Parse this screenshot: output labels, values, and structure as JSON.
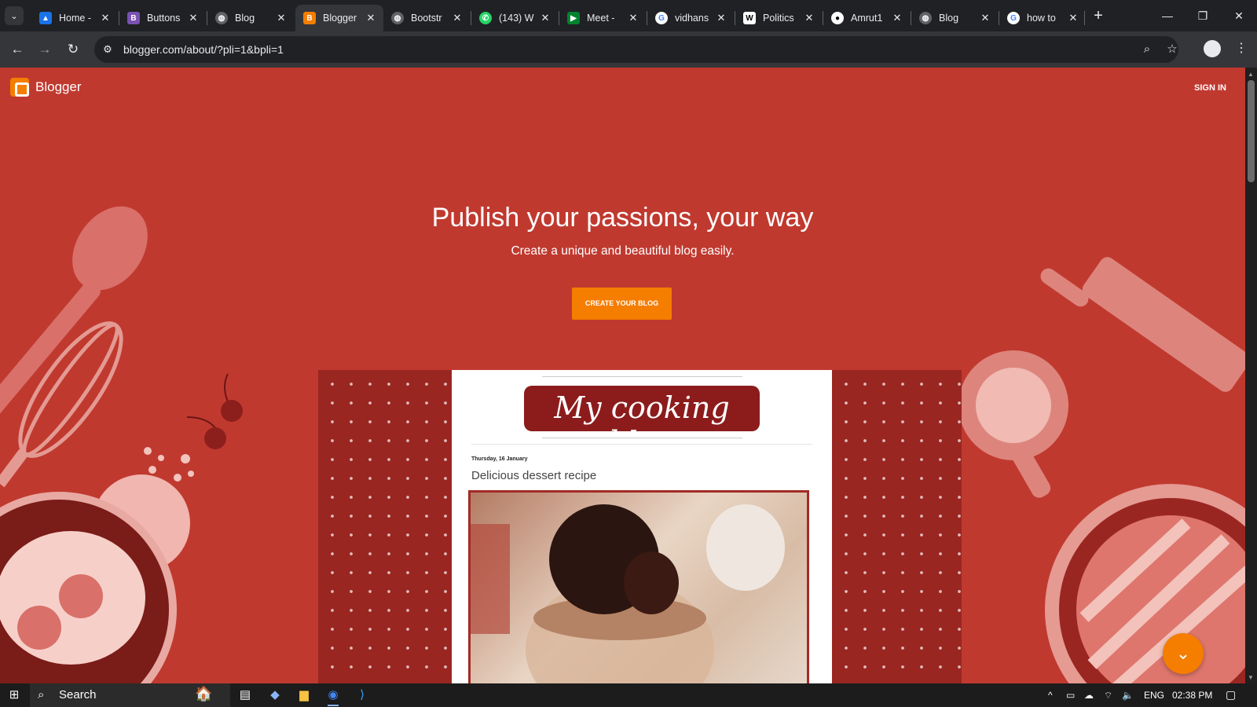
{
  "browser": {
    "tabs": [
      {
        "label": "Home -",
        "icon": "google-drive-icon",
        "color": "#4285f4"
      },
      {
        "label": "Buttons",
        "icon": "bootstrap-icon",
        "color": "#7952b3"
      },
      {
        "label": "Blog",
        "icon": "globe-icon",
        "color": "#9aa0a6"
      },
      {
        "label": "Blogger",
        "icon": "blogger-icon",
        "color": "#f57d00",
        "active": true
      },
      {
        "label": "Bootstr",
        "icon": "globe-icon",
        "color": "#9aa0a6"
      },
      {
        "label": "(143) W",
        "icon": "whatsapp-icon",
        "color": "#25d366"
      },
      {
        "label": "Meet -",
        "icon": "google-meet-icon",
        "color": "#00832d"
      },
      {
        "label": "vidhans",
        "icon": "google-icon",
        "color": "#ffffff"
      },
      {
        "label": "Politics",
        "icon": "wikipedia-icon",
        "color": "#ffffff"
      },
      {
        "label": "Amrut1",
        "icon": "github-icon",
        "color": "#ffffff"
      },
      {
        "label": "Blog",
        "icon": "globe-icon",
        "color": "#9aa0a6"
      },
      {
        "label": "how to",
        "icon": "google-icon",
        "color": "#ffffff"
      }
    ],
    "url": "blogger.com/about/?pli=1&bpli=1"
  },
  "page": {
    "brand": "Blogger",
    "sign_in": "SIGN IN",
    "headline": "Publish your passions, your way",
    "subline": "Create a unique and beautiful blog easily.",
    "cta": "CREATE YOUR BLOG",
    "accent": "#f57d00",
    "background": "#c0392f",
    "preview": {
      "blog_title": "My cooking blog",
      "date": "Thursday, 16 January",
      "post_title": "Delicious dessert recipe"
    }
  },
  "taskbar": {
    "search": "Search",
    "lang": "ENG",
    "time": "02:38 PM"
  }
}
